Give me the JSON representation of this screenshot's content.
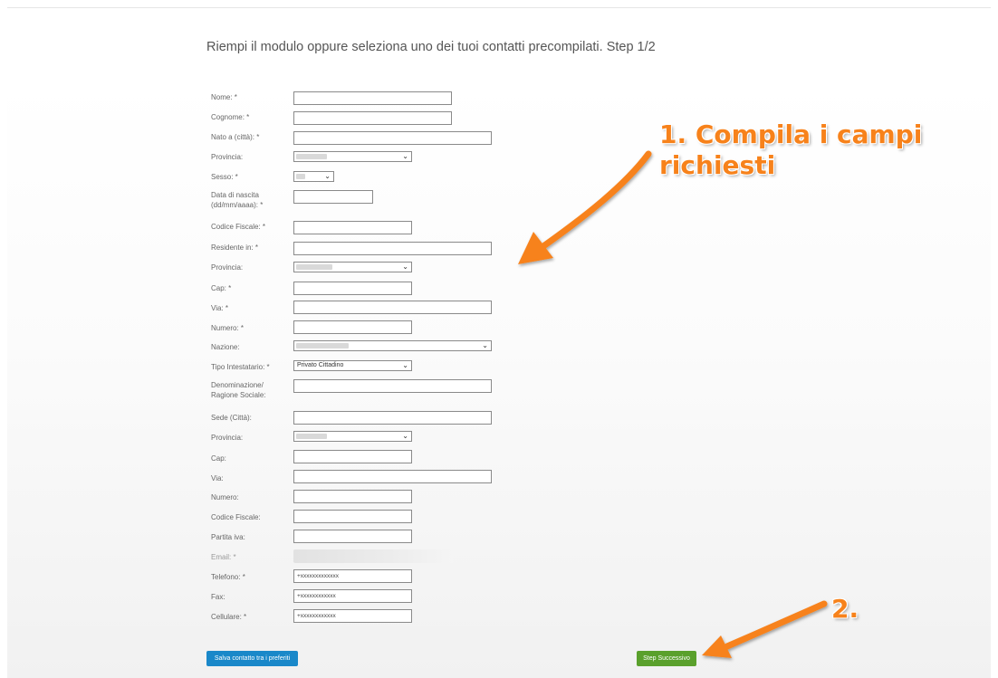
{
  "heading": "Riempi il modulo oppure seleziona uno dei tuoi contatti precompilati. Step 1/2",
  "fields": {
    "nome": {
      "label": "Nome: *",
      "value": ""
    },
    "cognome": {
      "label": "Cognome: *",
      "value": ""
    },
    "nato_a": {
      "label": "Nato a (città): *",
      "value": ""
    },
    "provincia1": {
      "label": "Provincia:"
    },
    "sesso": {
      "label": "Sesso: *"
    },
    "data_nascita": {
      "label1": "Data di nascita",
      "label2": "(dd/mm/aaaa): *",
      "value": ""
    },
    "codice_fiscale": {
      "label": "Codice Fiscale: *",
      "value": ""
    },
    "residente": {
      "label": "Residente in: *",
      "value": ""
    },
    "provincia2": {
      "label": "Provincia:"
    },
    "cap": {
      "label": "Cap: *",
      "value": ""
    },
    "via": {
      "label": "Via: *",
      "value": ""
    },
    "numero": {
      "label": "Numero: *",
      "value": ""
    },
    "nazione": {
      "label": "Nazione:"
    },
    "tipo_intestatario": {
      "label": "Tipo Intestatario: *",
      "value": "Privato Cittadino"
    },
    "denominazione": {
      "label1": "Denominazione/",
      "label2": "Ragione Sociale:",
      "value": ""
    },
    "sede": {
      "label": "Sede (Città):",
      "value": ""
    },
    "provincia3": {
      "label": "Provincia:"
    },
    "cap2": {
      "label": "Cap:",
      "value": ""
    },
    "via2": {
      "label": "Via:",
      "value": ""
    },
    "numero2": {
      "label": "Numero:",
      "value": ""
    },
    "codice_fiscale2": {
      "label": "Codice Fiscale:",
      "value": ""
    },
    "partita_iva": {
      "label": "Partita iva:",
      "value": ""
    },
    "email": {
      "label": "Email: *"
    },
    "telefono": {
      "label": "Telefono: *",
      "value": "+xxxxxxxxxxxxx"
    },
    "fax": {
      "label": "Fax:",
      "value": "+xxxxxxxxxxxx"
    },
    "cellulare": {
      "label": "Cellulare: *",
      "value": "+xxxxxxxxxxxx"
    }
  },
  "buttons": {
    "salva": "Salva contatto tra i preferiti",
    "step_successivo": "Step Successivo"
  },
  "annotations": {
    "one_line1": "1. Compila i campi",
    "one_line2": "richiesti",
    "two": "2."
  },
  "colors": {
    "accent_orange": "#f7821b",
    "button_blue": "#1a88c9",
    "button_green": "#5aa02c"
  }
}
